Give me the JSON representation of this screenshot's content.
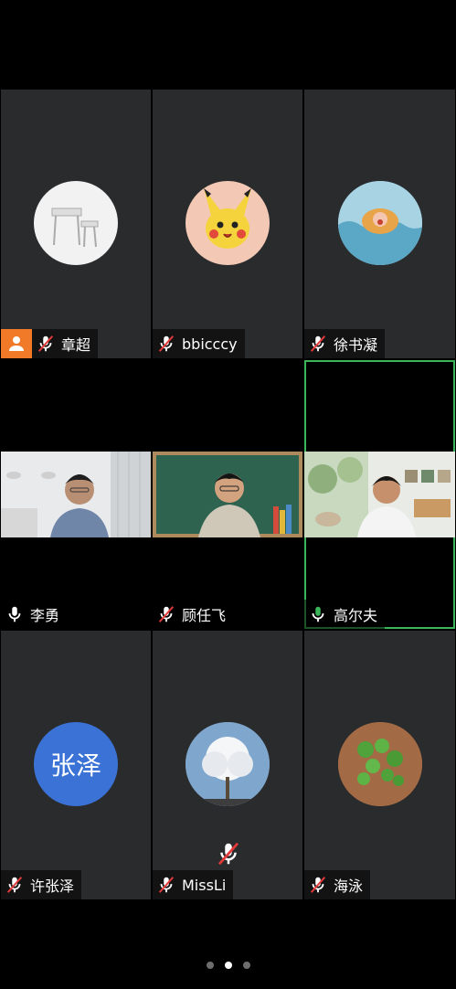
{
  "participants": [
    {
      "name": "章超",
      "muted": true,
      "host": true,
      "avatar": "desk-photo"
    },
    {
      "name": "bbicccy",
      "muted": true,
      "avatar": "pikachu-photo"
    },
    {
      "name": "徐书凝",
      "muted": true,
      "avatar": "swimming-child-photo"
    },
    {
      "name": "李勇",
      "muted": false,
      "video": true
    },
    {
      "name": "顾任飞",
      "muted": true,
      "video": true
    },
    {
      "name": "高尔夫",
      "muted": false,
      "speaking": true,
      "video": true
    },
    {
      "name": "许张泽",
      "muted": true,
      "avatar_text": "张泽"
    },
    {
      "name": "MissLi",
      "muted": true,
      "avatar": "white-tree-photo"
    },
    {
      "name": "海泳",
      "muted": true,
      "avatar": "green-plants-photo"
    }
  ],
  "pagination": {
    "pages": 3,
    "current": 2
  },
  "colors": {
    "tile_bg": "#2a2b2d",
    "host_badge": "#f07a27",
    "active_border": "#3cb55a",
    "text_avatar": "#3b72d6",
    "speaking_mic": "#3cb55a"
  }
}
